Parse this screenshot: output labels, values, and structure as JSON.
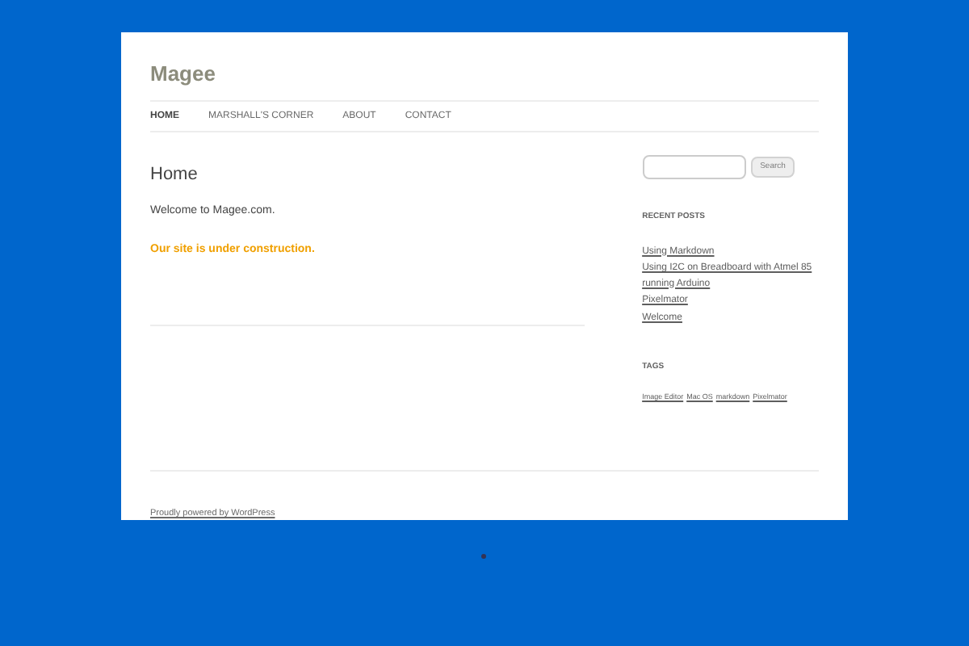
{
  "site_title": "Magee",
  "nav": [
    {
      "label": "HOME",
      "selected": true
    },
    {
      "label": "MARSHALL'S CORNER",
      "selected": false
    },
    {
      "label": "ABOUT",
      "selected": false
    },
    {
      "label": "CONTACT",
      "selected": false
    }
  ],
  "page": {
    "title": "Home",
    "intro": "Welcome to Magee.com.",
    "notice": "Our site is under construction."
  },
  "search": {
    "button": "Search"
  },
  "recent_posts": {
    "heading": "RECENT POSTS",
    "items": [
      "Using Markdown",
      "Using I2C on Breadboard with Atmel 85 running Arduino",
      "Pixelmator",
      "Welcome"
    ]
  },
  "tags": {
    "heading": "TAGS",
    "items": [
      "Image Editor",
      "Mac OS",
      "markdown",
      "Pixelmator"
    ]
  },
  "footer": {
    "credit": "Proudly powered by WordPress"
  }
}
